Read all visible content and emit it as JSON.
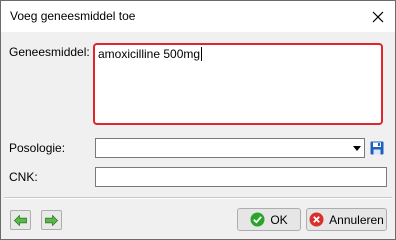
{
  "window": {
    "title": "Voeg geneesmiddel toe"
  },
  "form": {
    "medicine_label": "Geneesmiddel:",
    "medicine_value": "amoxicilline 500mg",
    "dosage_label": "Posologie:",
    "dosage_value": "",
    "cnk_label": "CNK:",
    "cnk_value": ""
  },
  "buttons": {
    "ok_label": "OK",
    "cancel_label": "Annuleren"
  },
  "colors": {
    "memo_focus_border": "#e0262c",
    "nav_arrow": "#3a9a2a",
    "ok_icon": "#2aa52a",
    "cancel_icon": "#d9302c",
    "save_icon": "#1f5fbf"
  },
  "icons": {
    "close": "close-icon",
    "dropdown": "chevron-down-icon",
    "save": "floppy-disk-icon",
    "prev": "arrow-left-icon",
    "next": "arrow-right-icon",
    "ok": "checkmark-icon",
    "cancel": "cancel-icon"
  }
}
